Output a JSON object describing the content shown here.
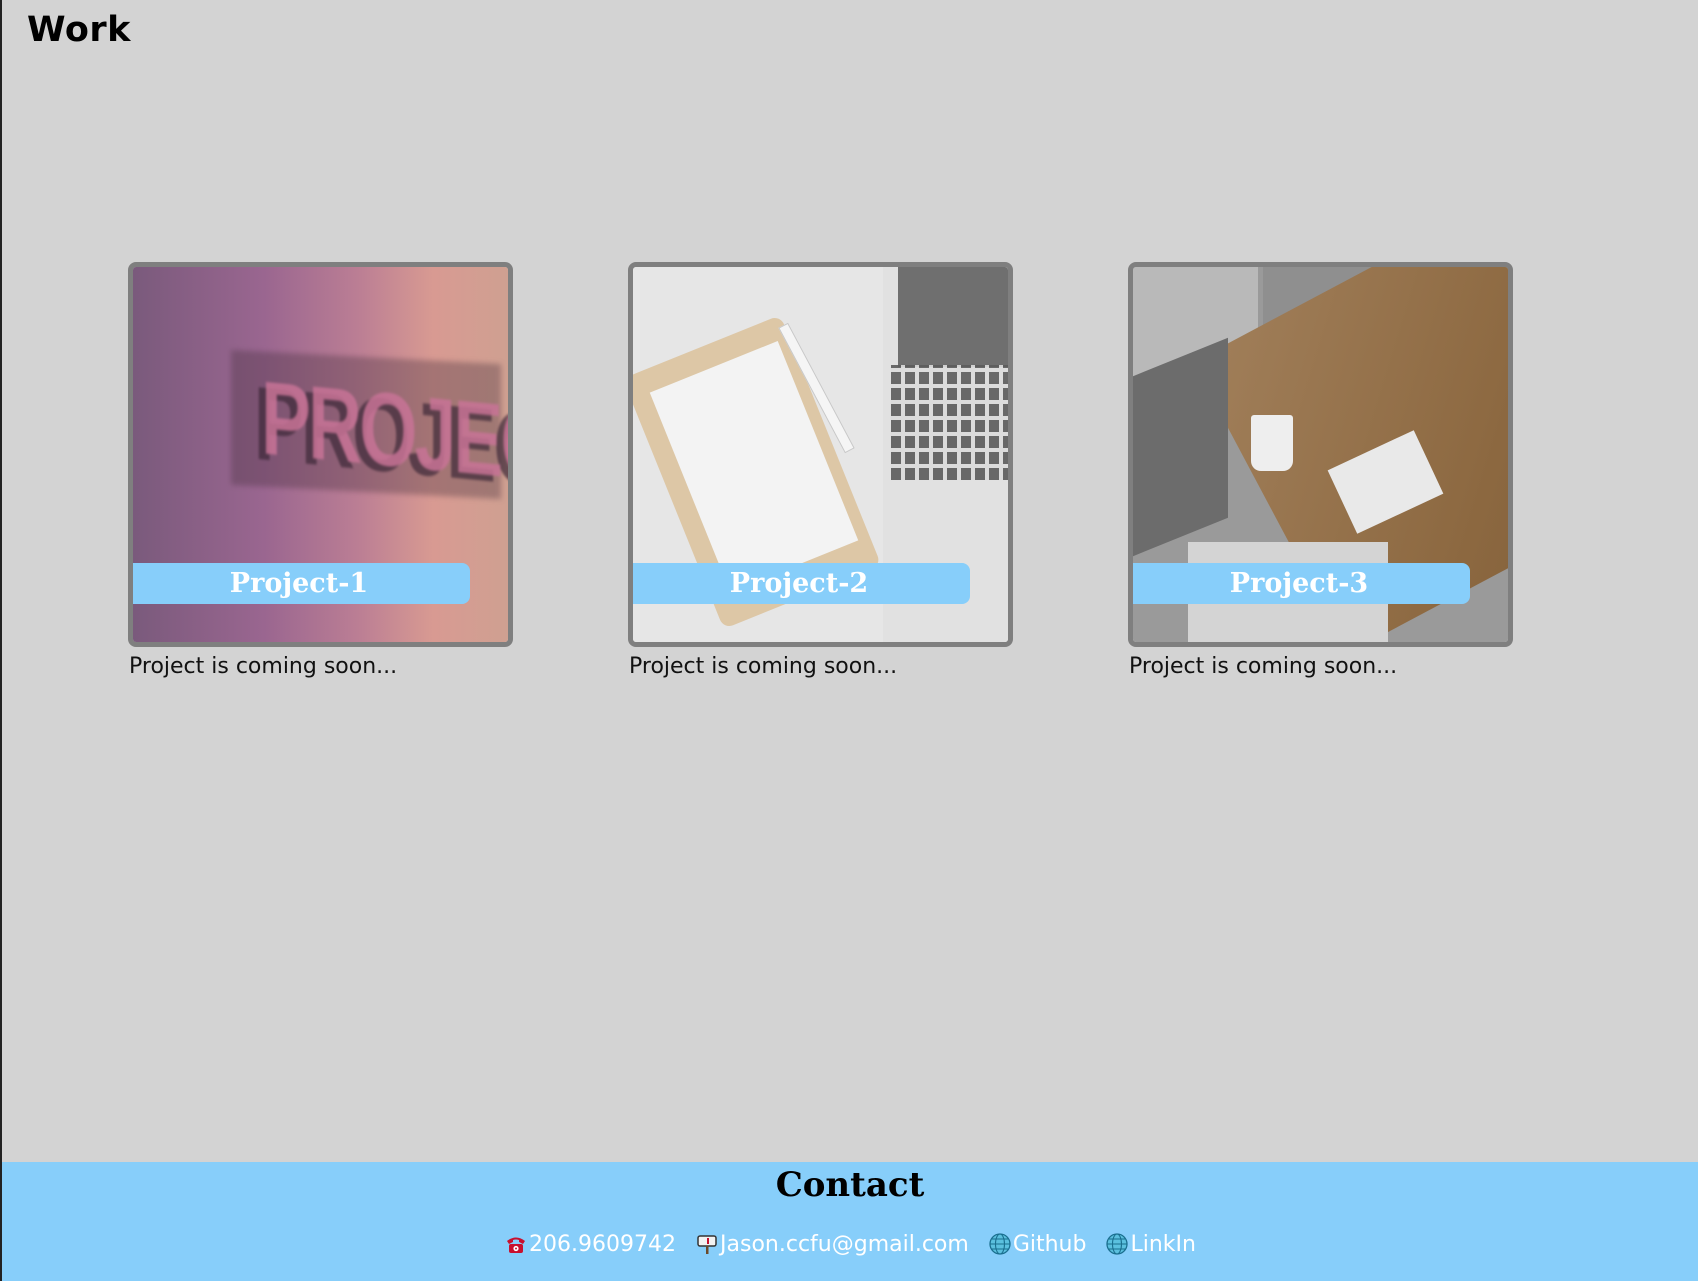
{
  "section": {
    "title": "Work"
  },
  "projects": [
    {
      "label": "Project-1",
      "description": "Project is coming soon...",
      "image_text": "PROJECTS"
    },
    {
      "label": "Project-2",
      "description": "Project is coming soon..."
    },
    {
      "label": "Project-3",
      "description": "Project is coming soon..."
    }
  ],
  "footer": {
    "title": "Contact",
    "phone": "206.9609742",
    "email": "Jason.ccfu@gmail.com",
    "github": "Github",
    "linkedin": "LinkIn"
  },
  "colors": {
    "background": "#d3d3d3",
    "accent": "#87cefa",
    "card_border": "#7f7f7f"
  },
  "icons": [
    "telephone-icon",
    "mailbox-icon",
    "globe-icon",
    "globe-icon"
  ]
}
